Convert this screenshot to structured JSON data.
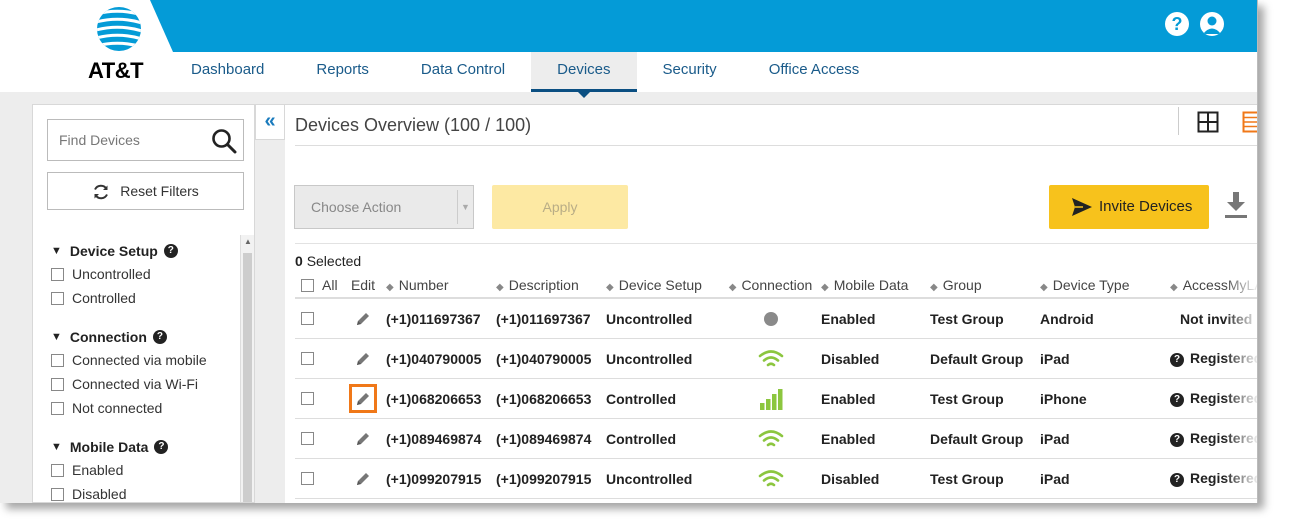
{
  "brand": {
    "logo_text": "AT&T",
    "color_blue": "#049bd7",
    "color_nav": "#1a5b8a"
  },
  "top_icons": {
    "help": "?",
    "user": "user-icon"
  },
  "nav": {
    "items": [
      {
        "label": "Dashboard"
      },
      {
        "label": "Reports"
      },
      {
        "label": "Data Control"
      },
      {
        "label": "Devices",
        "active": true
      },
      {
        "label": "Security"
      },
      {
        "label": "Office Access"
      }
    ]
  },
  "sidebar": {
    "search": {
      "placeholder": "Find Devices"
    },
    "reset_label": "Reset Filters",
    "groups": [
      {
        "title": "Device Setup",
        "items": [
          "Uncontrolled",
          "Controlled"
        ]
      },
      {
        "title": "Connection",
        "items": [
          "Connected via mobile",
          "Connected via Wi-Fi",
          "Not connected"
        ]
      },
      {
        "title": "Mobile Data",
        "items": [
          "Enabled",
          "Disabled"
        ]
      }
    ]
  },
  "main": {
    "title": "Devices Overview (100 / 100)",
    "choose_action": "Choose Action",
    "apply": "Apply",
    "invite": "Invite Devices",
    "selected": {
      "count": "0",
      "label": "Selected"
    },
    "columns": {
      "all": "All",
      "edit": "Edit",
      "number": "Number",
      "description": "Description",
      "device_setup": "Device Setup",
      "connection": "Connection",
      "mobile_data": "Mobile Data",
      "group": "Group",
      "device_type": "Device Type",
      "access": "AccessMyLA"
    },
    "rows": [
      {
        "number": "(+1)011697367",
        "description": "(+1)011697367",
        "setup": "Uncontrolled",
        "connection": "none",
        "mobile": "Enabled",
        "group": "Test Group",
        "type": "Android",
        "access": "Not invited",
        "access_icon": false,
        "highlight": false
      },
      {
        "number": "(+1)040790005",
        "description": "(+1)040790005",
        "setup": "Uncontrolled",
        "connection": "wifi",
        "mobile": "Disabled",
        "group": "Default Group",
        "type": "iPad",
        "access": "Registered",
        "access_icon": true,
        "highlight": false
      },
      {
        "number": "(+1)068206653",
        "description": "(+1)068206653",
        "setup": "Controlled",
        "connection": "mobile",
        "mobile": "Enabled",
        "group": "Test Group",
        "type": "iPhone",
        "access": "Registered",
        "access_icon": true,
        "highlight": true
      },
      {
        "number": "(+1)089469874",
        "description": "(+1)089469874",
        "setup": "Controlled",
        "connection": "wifi",
        "mobile": "Enabled",
        "group": "Default Group",
        "type": "iPad",
        "access": "Registered",
        "access_icon": true,
        "highlight": false
      },
      {
        "number": "(+1)099207915",
        "description": "(+1)099207915",
        "setup": "Uncontrolled",
        "connection": "wifi",
        "mobile": "Disabled",
        "group": "Test Group",
        "type": "iPad",
        "access": "Registered",
        "access_icon": true,
        "highlight": false
      }
    ],
    "colors": {
      "wifi": "#8cc63f",
      "none": "#8a8a8a",
      "highlight": "#f07818",
      "invite": "#f7c21c",
      "apply": "#fde9a3"
    }
  }
}
